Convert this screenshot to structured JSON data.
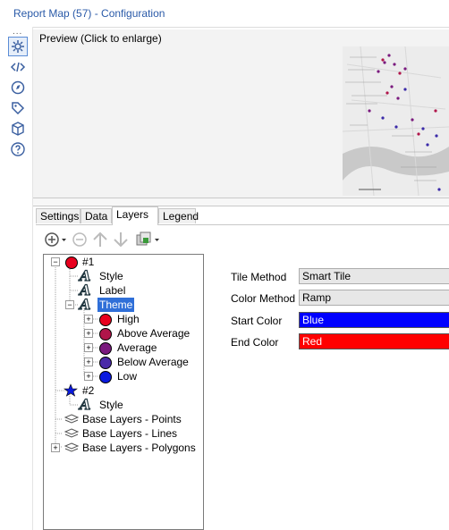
{
  "window": {
    "title": "Report Map (57) - Configuration"
  },
  "sidebar": {
    "dots": "...",
    "icons": [
      "gear-icon",
      "code-icon",
      "compass-icon",
      "tag-icon",
      "cube-icon",
      "help-icon"
    ]
  },
  "preview": {
    "label": "Preview (Click to enlarge)"
  },
  "tabs": [
    "Settings",
    "Data",
    "Layers",
    "Legend"
  ],
  "active_tab": "Layers",
  "tree": {
    "layer1": {
      "label": "#1",
      "style": "Style",
      "label_item": "Label",
      "theme": "Theme",
      "theme_items": [
        {
          "label": "High",
          "color": "#e8001e"
        },
        {
          "label": "Above Average",
          "color": "#b0154a"
        },
        {
          "label": "Average",
          "color": "#7a1a7e"
        },
        {
          "label": "Below Average",
          "color": "#4a2aa8"
        },
        {
          "label": "Low",
          "color": "#0a1adf"
        }
      ]
    },
    "layer2": {
      "label": "#2",
      "style": "Style"
    },
    "base": [
      "Base Layers - Points",
      "Base Layers - Lines",
      "Base Layers - Polygons"
    ]
  },
  "properties": {
    "tile_method": {
      "label": "Tile Method",
      "value": "Smart Tile"
    },
    "color_method": {
      "label": "Color Method",
      "value": "Ramp"
    },
    "start_color": {
      "label": "Start Color",
      "value": "Blue",
      "color": "#0000ff"
    },
    "end_color": {
      "label": "End Color",
      "value": "Red",
      "color": "#ff0000"
    }
  },
  "colors": {
    "layer1_marker": "#e8001e",
    "layer2_marker": "#0a1adf",
    "selection": "#2f6fd8",
    "title_text": "#2a5aa8"
  }
}
